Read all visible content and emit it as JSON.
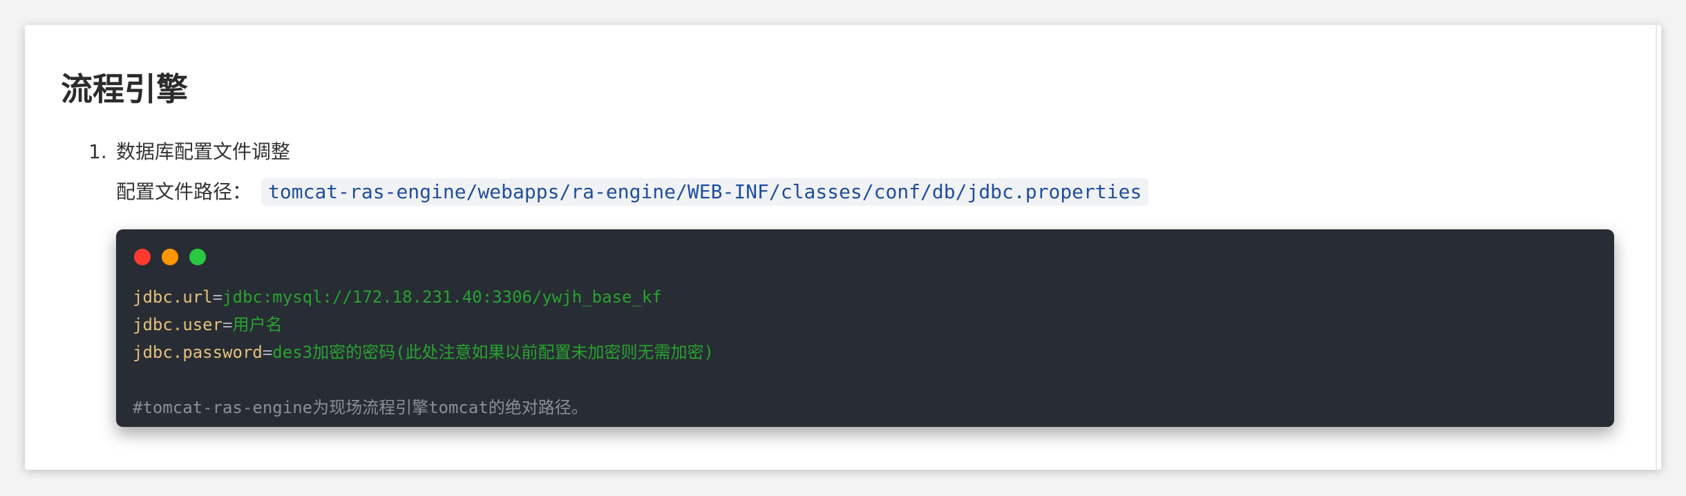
{
  "heading": "流程引擎",
  "list": {
    "item_number": "1.",
    "item_title": "数据库配置文件调整",
    "path_label": "配置文件路径：",
    "path_value": "tomcat-ras-engine/webapps/ra-engine/WEB-INF/classes/conf/db/jdbc.properties"
  },
  "code_block": {
    "lines": [
      {
        "key": "jdbc.url",
        "sep": "=",
        "value": "jdbc:mysql://172.18.231.40:3306/ywjh_base_kf"
      },
      {
        "key": "jdbc.user",
        "sep": "=",
        "value": "用户名"
      },
      {
        "key": "jdbc.password",
        "sep": "=",
        "value": "des3加密的密码(此处注意如果以前配置未加密则无需加密)"
      }
    ],
    "comment": "#tomcat-ras-engine为现场流程引擎tomcat的绝对路径。"
  },
  "colors": {
    "code_background": "#282c34",
    "key": "#e5c07b",
    "value": "#27a32f",
    "comment": "#8a8f98",
    "dot_red": "#ff3b30",
    "dot_orange": "#ff9500",
    "dot_green": "#28c840"
  }
}
